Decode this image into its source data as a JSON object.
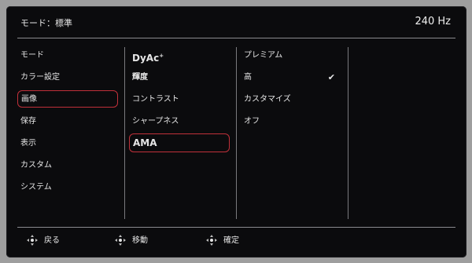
{
  "header": {
    "mode_label": "モード：標準",
    "refresh_rate": "240 Hz"
  },
  "menu": {
    "column1": [
      {
        "label": "モード",
        "selected": false
      },
      {
        "label": "カラー設定",
        "selected": false
      },
      {
        "label": "画像",
        "selected": true
      },
      {
        "label": "保存",
        "selected": false
      },
      {
        "label": "表示",
        "selected": false
      },
      {
        "label": "カスタム",
        "selected": false
      },
      {
        "label": "システム",
        "selected": false
      }
    ],
    "column2": {
      "dyac_label": "DyAc",
      "dyac_sup": "+",
      "items": [
        {
          "label": "輝度",
          "selected": false
        },
        {
          "label": "コントラスト",
          "selected": false
        },
        {
          "label": "シャープネス",
          "selected": false
        },
        {
          "label": "AMA",
          "selected": true
        }
      ]
    },
    "column3": [
      {
        "label": "プレミアム",
        "checked": false
      },
      {
        "label": "高",
        "checked": true
      },
      {
        "label": "カスタマイズ",
        "checked": false
      },
      {
        "label": "オフ",
        "checked": false
      }
    ],
    "check_glyph": "✔"
  },
  "footer": {
    "back": "戻る",
    "move": "移動",
    "confirm": "確定"
  },
  "colors": {
    "osd_background": "#0b0b0d",
    "selection_border": "#c0303a",
    "text": "#e6e6e6"
  }
}
